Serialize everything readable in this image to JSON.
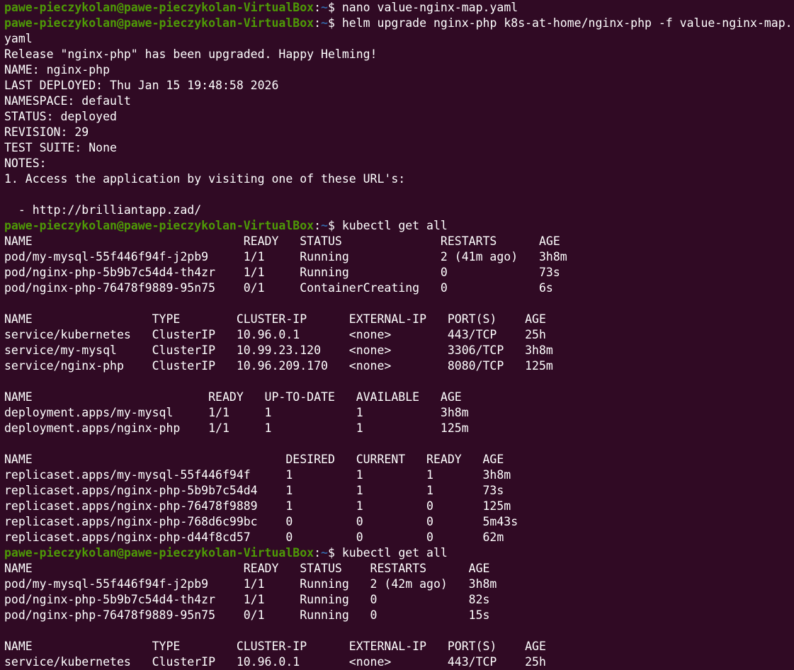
{
  "terminal": {
    "lines": [
      {
        "type": "prompt",
        "user": "pawe-pieczykolan@pawe-pieczykolan-VirtualBox",
        "path": "~",
        "command": "nano value-nginx-map.yaml"
      },
      {
        "type": "prompt",
        "user": "pawe-pieczykolan@pawe-pieczykolan-VirtualBox",
        "path": "~",
        "command": "helm upgrade nginx-php k8s-at-home/nginx-php -f value-nginx-map."
      },
      {
        "type": "output",
        "text": "yaml"
      },
      {
        "type": "output",
        "text": "Release \"nginx-php\" has been upgraded. Happy Helming!"
      },
      {
        "type": "output",
        "text": "NAME: nginx-php"
      },
      {
        "type": "output",
        "text": "LAST DEPLOYED: Thu Jan 15 19:48:58 2026"
      },
      {
        "type": "output",
        "text": "NAMESPACE: default"
      },
      {
        "type": "output",
        "text": "STATUS: deployed"
      },
      {
        "type": "output",
        "text": "REVISION: 29"
      },
      {
        "type": "output",
        "text": "TEST SUITE: None"
      },
      {
        "type": "output",
        "text": "NOTES:"
      },
      {
        "type": "output",
        "text": "1. Access the application by visiting one of these URL's:"
      },
      {
        "type": "output",
        "text": ""
      },
      {
        "type": "output",
        "text": "  - http://brilliantapp.zad/"
      },
      {
        "type": "prompt",
        "user": "pawe-pieczykolan@pawe-pieczykolan-VirtualBox",
        "path": "~",
        "command": "kubectl get all"
      },
      {
        "type": "output",
        "text": "NAME                              READY   STATUS              RESTARTS      AGE"
      },
      {
        "type": "output",
        "text": "pod/my-mysql-55f446f94f-j2pb9     1/1     Running             2 (41m ago)   3h8m"
      },
      {
        "type": "output",
        "text": "pod/nginx-php-5b9b7c54d4-th4zr    1/1     Running             0             73s"
      },
      {
        "type": "output",
        "text": "pod/nginx-php-76478f9889-95n75    0/1     ContainerCreating   0             6s"
      },
      {
        "type": "output",
        "text": ""
      },
      {
        "type": "output",
        "text": "NAME                 TYPE        CLUSTER-IP      EXTERNAL-IP   PORT(S)    AGE"
      },
      {
        "type": "output",
        "text": "service/kubernetes   ClusterIP   10.96.0.1       <none>        443/TCP    25h"
      },
      {
        "type": "output",
        "text": "service/my-mysql     ClusterIP   10.99.23.120    <none>        3306/TCP   3h8m"
      },
      {
        "type": "output",
        "text": "service/nginx-php    ClusterIP   10.96.209.170   <none>        8080/TCP   125m"
      },
      {
        "type": "output",
        "text": ""
      },
      {
        "type": "output",
        "text": "NAME                         READY   UP-TO-DATE   AVAILABLE   AGE"
      },
      {
        "type": "output",
        "text": "deployment.apps/my-mysql     1/1     1            1           3h8m"
      },
      {
        "type": "output",
        "text": "deployment.apps/nginx-php    1/1     1            1           125m"
      },
      {
        "type": "output",
        "text": ""
      },
      {
        "type": "output",
        "text": "NAME                                    DESIRED   CURRENT   READY   AGE"
      },
      {
        "type": "output",
        "text": "replicaset.apps/my-mysql-55f446f94f     1         1         1       3h8m"
      },
      {
        "type": "output",
        "text": "replicaset.apps/nginx-php-5b9b7c54d4    1         1         1       73s"
      },
      {
        "type": "output",
        "text": "replicaset.apps/nginx-php-76478f9889    1         1         0       125m"
      },
      {
        "type": "output",
        "text": "replicaset.apps/nginx-php-768d6c99bc    0         0         0       5m43s"
      },
      {
        "type": "output",
        "text": "replicaset.apps/nginx-php-d44f8cd57     0         0         0       62m"
      },
      {
        "type": "prompt",
        "user": "pawe-pieczykolan@pawe-pieczykolan-VirtualBox",
        "path": "~",
        "command": "kubectl get all"
      },
      {
        "type": "output",
        "text": "NAME                              READY   STATUS    RESTARTS      AGE"
      },
      {
        "type": "output",
        "text": "pod/my-mysql-55f446f94f-j2pb9     1/1     Running   2 (42m ago)   3h8m"
      },
      {
        "type": "output",
        "text": "pod/nginx-php-5b9b7c54d4-th4zr    1/1     Running   0             82s"
      },
      {
        "type": "output",
        "text": "pod/nginx-php-76478f9889-95n75    0/1     Running   0             15s"
      },
      {
        "type": "output",
        "text": ""
      },
      {
        "type": "output",
        "text": "NAME                 TYPE        CLUSTER-IP      EXTERNAL-IP   PORT(S)    AGE"
      },
      {
        "type": "output",
        "text": "service/kubernetes   ClusterIP   10.96.0.1       <none>        443/TCP    25h"
      }
    ]
  },
  "colors": {
    "background": "#300a24",
    "prompt_user": "#4e9a06",
    "prompt_path": "#3465a4",
    "text": "#ffffff"
  }
}
